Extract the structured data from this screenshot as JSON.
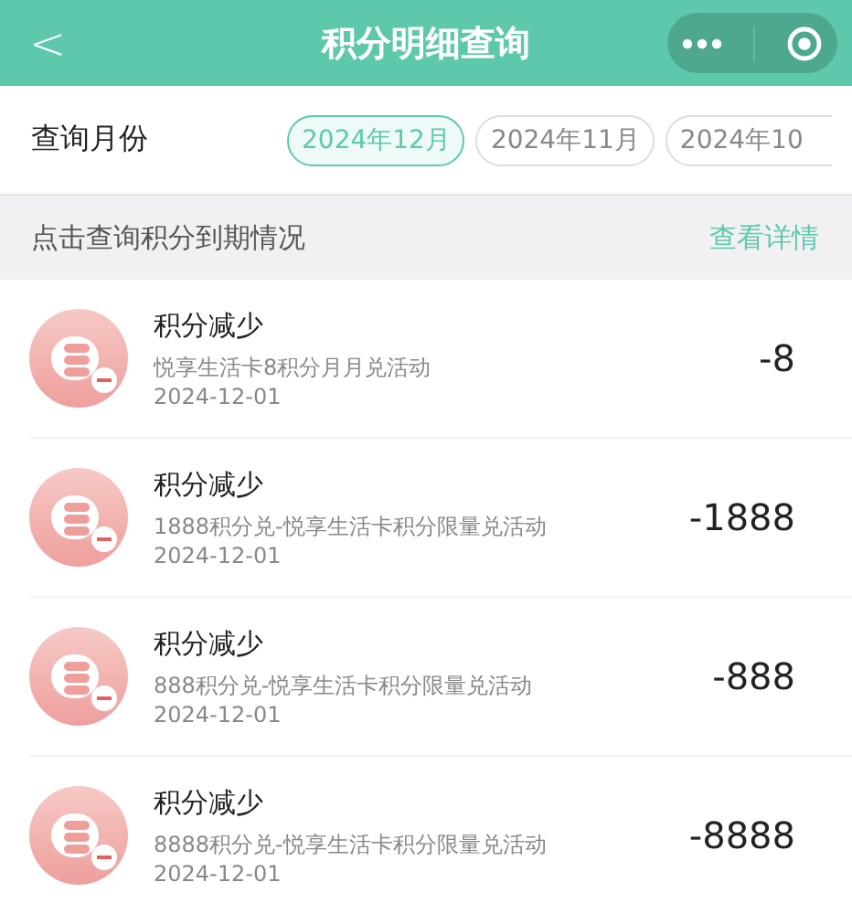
{
  "header": {
    "title": "积分明细查询",
    "back": "<"
  },
  "month_filter": {
    "label": "查询月份",
    "months": [
      {
        "label": "2024年12月",
        "selected": true
      },
      {
        "label": "2024年11月",
        "selected": false
      },
      {
        "label": "2024年10",
        "selected": false
      }
    ]
  },
  "expiry_notice": {
    "text": "点击查询积分到期情况",
    "link": "查看详情"
  },
  "records": [
    {
      "title": "积分减少",
      "description": "悦享生活卡8积分月月兑活动",
      "date": "2024-12-01",
      "amount": "-8"
    },
    {
      "title": "积分减少",
      "description": "1888积分兑-悦享生活卡积分限量兑活动",
      "date": "2024-12-01",
      "amount": "-1888"
    },
    {
      "title": "积分减少",
      "description": "888积分兑-悦享生活卡积分限量兑活动",
      "date": "2024-12-01",
      "amount": "-888"
    },
    {
      "title": "积分减少",
      "description": "8888积分兑-悦享生活卡积分限量兑活动",
      "date": "2024-12-01",
      "amount": "-8888"
    }
  ]
}
